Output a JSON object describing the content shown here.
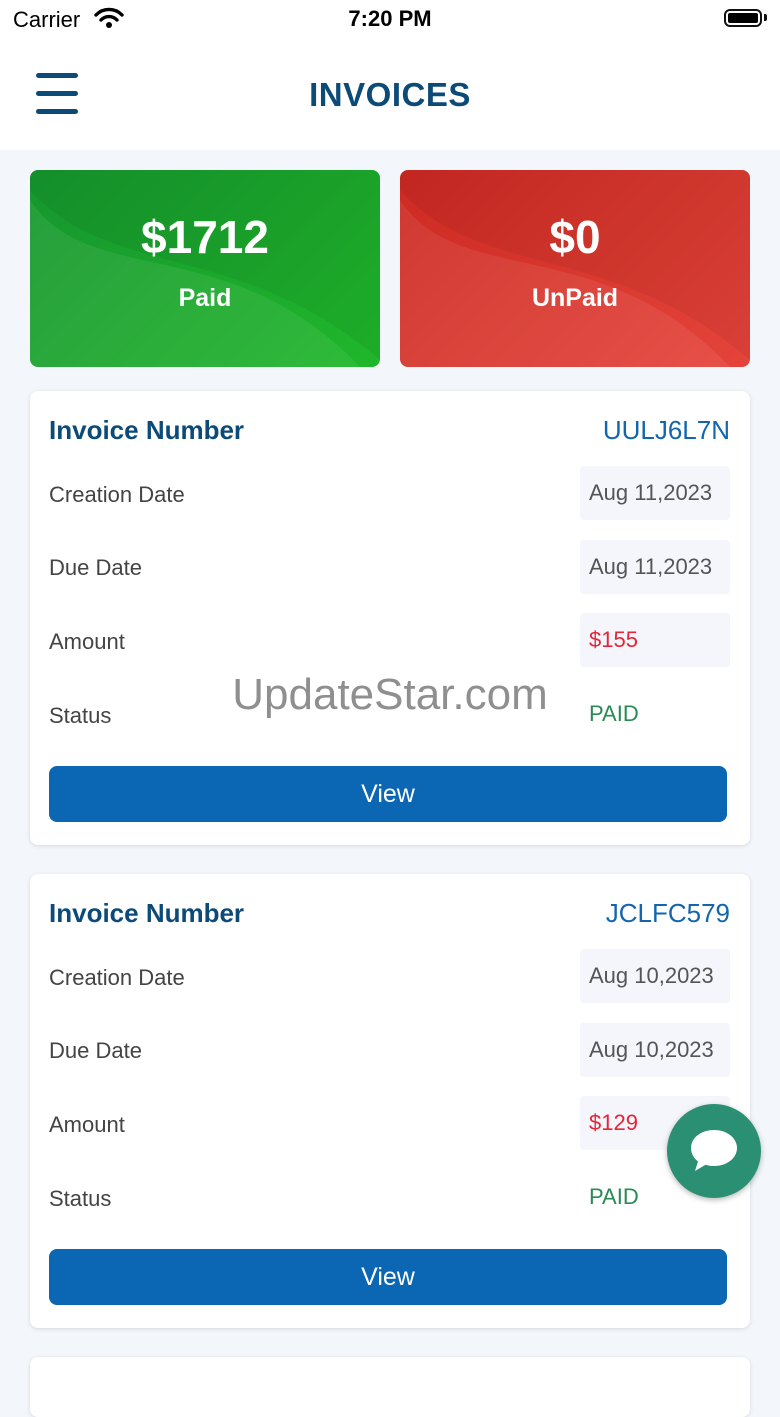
{
  "status_bar": {
    "carrier": "Carrier",
    "time": "7:20 PM"
  },
  "header": {
    "title": "INVOICES",
    "menu_icon": "hamburger-menu-icon"
  },
  "summary": {
    "paid": {
      "amount": "$1712",
      "label": "Paid",
      "color": "#20b72b"
    },
    "unpaid": {
      "amount": "$0",
      "label": "UnPaid",
      "color": "#e5443a"
    }
  },
  "invoices": [
    {
      "title": "Invoice Number",
      "number": "UULJ6L7N",
      "creation_label": "Creation Date",
      "creation_value": "Aug 11,2023",
      "due_label": "Due Date",
      "due_value": "Aug 11,2023",
      "amount_label": "Amount",
      "amount_value": "$155",
      "status_label": "Status",
      "status_value": "PAID",
      "button": "View"
    },
    {
      "title": "Invoice Number",
      "number": "JCLFC579",
      "creation_label": "Creation Date",
      "creation_value": "Aug 10,2023",
      "due_label": "Due Date",
      "due_value": "Aug 10,2023",
      "amount_label": "Amount",
      "amount_value": "$129",
      "status_label": "Status",
      "status_value": "PAID",
      "button": "View"
    }
  ],
  "watermark": "UpdateStar.com",
  "chat_button": {
    "icon": "chat-bubble-icon",
    "color": "#2b8f73"
  },
  "colors": {
    "primary": "#0c4a78",
    "button": "#0b67b4",
    "amount": "#e3263a",
    "status_paid": "#2a8a54"
  }
}
